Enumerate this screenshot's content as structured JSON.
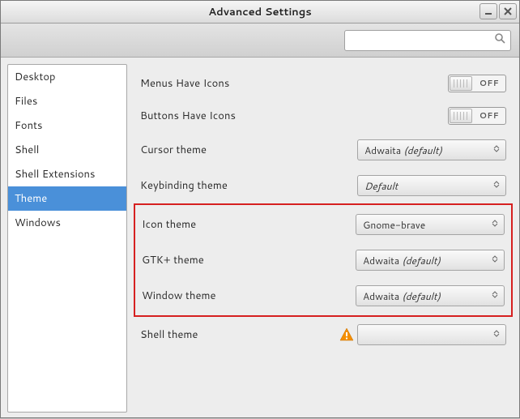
{
  "window": {
    "title": "Advanced Settings"
  },
  "search": {
    "placeholder": ""
  },
  "sidebar": {
    "items": [
      {
        "label": "Desktop"
      },
      {
        "label": "Files"
      },
      {
        "label": "Fonts"
      },
      {
        "label": "Shell"
      },
      {
        "label": "Shell Extensions"
      },
      {
        "label": "Theme"
      },
      {
        "label": "Windows"
      }
    ],
    "selected_index": 5
  },
  "settings": {
    "menus_have_icons": {
      "label": "Menus Have Icons",
      "state_text": "OFF"
    },
    "buttons_have_icons": {
      "label": "Buttons Have Icons",
      "state_text": "OFF"
    },
    "cursor_theme": {
      "label": "Cursor theme",
      "value": "Adwaita",
      "default_suffix": "(default)"
    },
    "keybinding_theme": {
      "label": "Keybinding theme",
      "value": "Default"
    },
    "icon_theme": {
      "label": "Icon theme",
      "value": "Gnome-brave"
    },
    "gtk_theme": {
      "label": "GTK+ theme",
      "value": "Adwaita",
      "default_suffix": "(default)"
    },
    "window_theme": {
      "label": "Window theme",
      "value": "Adwaita",
      "default_suffix": "(default)"
    },
    "shell_theme": {
      "label": "Shell theme",
      "value": ""
    }
  },
  "colors": {
    "selection": "#4a90d9",
    "highlight_border": "#d62020"
  }
}
